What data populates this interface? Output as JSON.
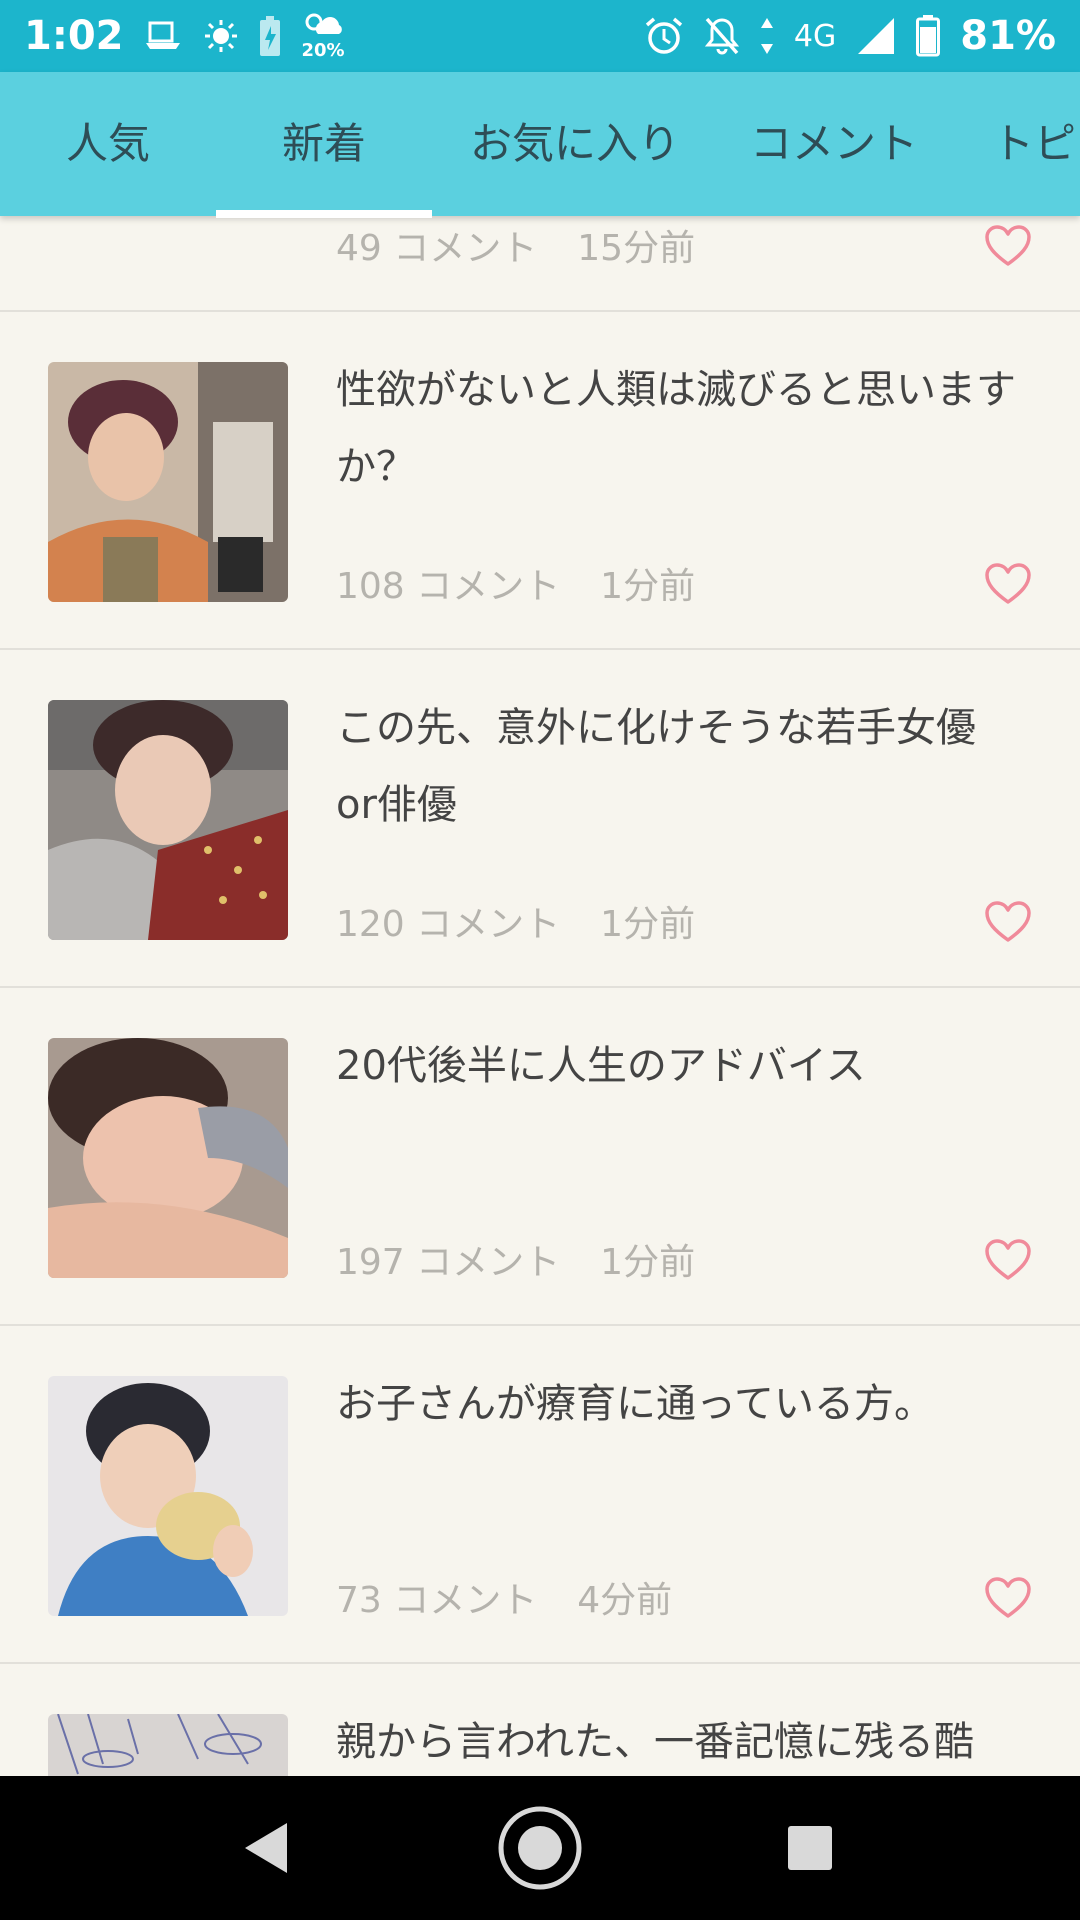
{
  "status_bar": {
    "time": "1:02",
    "weather_label": "20%",
    "network": "4G",
    "battery": "81%",
    "icons": [
      "notification-icon",
      "brightness-icon",
      "battery-saver-icon",
      "weather-icon",
      "alarm-icon",
      "bell-off-icon",
      "data-arrows-icon",
      "signal-icon",
      "battery-icon"
    ]
  },
  "tabs": [
    {
      "label": "人気"
    },
    {
      "label": "新着"
    },
    {
      "label": "お気に入り"
    },
    {
      "label": "コメント"
    },
    {
      "label": "トピ"
    }
  ],
  "active_tab": "新着",
  "feed": {
    "items": [
      {
        "title": "",
        "comments": "49 コメント",
        "time": "15分前"
      },
      {
        "title": "性欲がないと人類は滅びると思いますか？",
        "comments": "108 コメント",
        "time": "1分前"
      },
      {
        "title": "この先、意外に化けそうな若手女優or俳優",
        "comments": "120 コメント",
        "time": "1分前"
      },
      {
        "title": "20代後半に人生のアドバイス",
        "comments": "197 コメント",
        "time": "1分前"
      },
      {
        "title": "お子さんが療育に通っている方。",
        "comments": "73 コメント",
        "time": "4分前"
      },
      {
        "title": "親から言われた、一番記憶に残る酷",
        "comments": "",
        "time": ""
      }
    ]
  },
  "colors": {
    "status_bar": "#1cb5cc",
    "tab_bar": "#5bd0df",
    "background": "#f7f5ee",
    "heart": "#f08a9a"
  }
}
